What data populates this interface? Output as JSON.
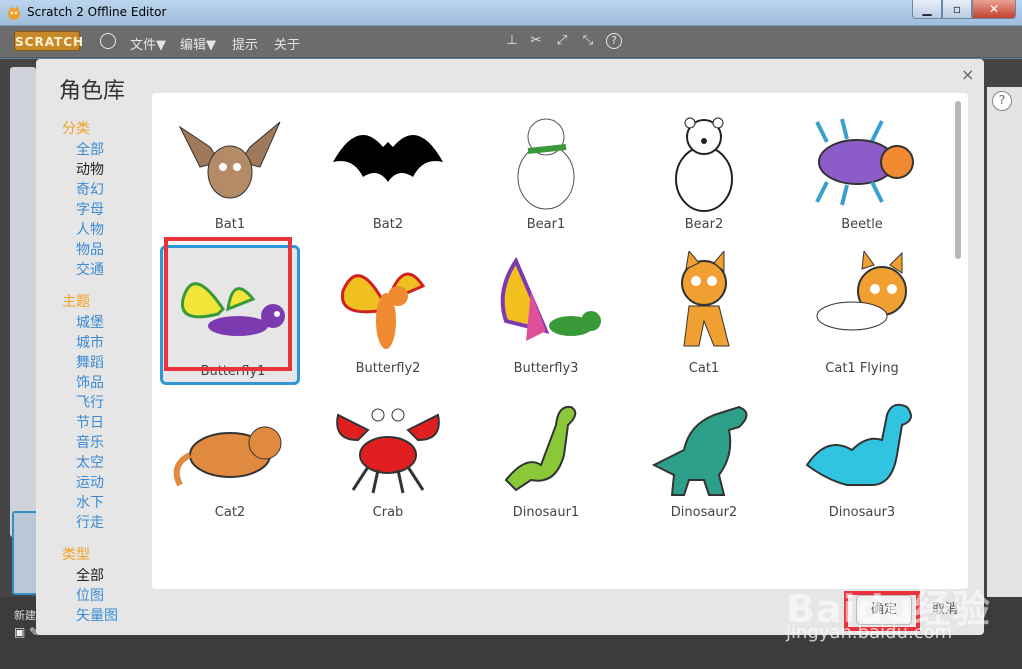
{
  "window": {
    "title": "Scratch 2 Offline Editor"
  },
  "menubar": {
    "logo": "SCRATCH",
    "file": "文件▼",
    "edit": "编辑▼",
    "tips": "提示",
    "about": "关于"
  },
  "underlay": {
    "new_label": "新建",
    "help": "?"
  },
  "dialog": {
    "title": "角色库",
    "close": "×",
    "sections": [
      {
        "title": "分类",
        "items": [
          "全部",
          "动物",
          "奇幻",
          "字母",
          "人物",
          "物品",
          "交通"
        ],
        "active": 1
      },
      {
        "title": "主题",
        "items": [
          "城堡",
          "城市",
          "舞蹈",
          "饰品",
          "飞行",
          "节日",
          "音乐",
          "太空",
          "运动",
          "水下",
          "行走"
        ]
      },
      {
        "title": "类型",
        "items": [
          "全部",
          "位图",
          "矢量图"
        ],
        "active": 0
      }
    ],
    "sprites": [
      "Bat1",
      "Bat2",
      "Bear1",
      "Bear2",
      "Beetle",
      "Butterfly1",
      "Butterfly2",
      "Butterfly3",
      "Cat1",
      "Cat1 Flying",
      "Cat2",
      "Crab",
      "Dinosaur1",
      "Dinosaur2",
      "Dinosaur3",
      "",
      "",
      "",
      "",
      ""
    ],
    "selected": "Butterfly1",
    "ok": "确定",
    "cancel": "取消"
  },
  "watermark": {
    "line1": "Baidu经验",
    "line2": "jingyan.baidu.com"
  },
  "colors": {
    "highlight": "#e8323c",
    "selection": "#2f97d6",
    "section": "#f5a020",
    "link": "#3b8bd4"
  }
}
